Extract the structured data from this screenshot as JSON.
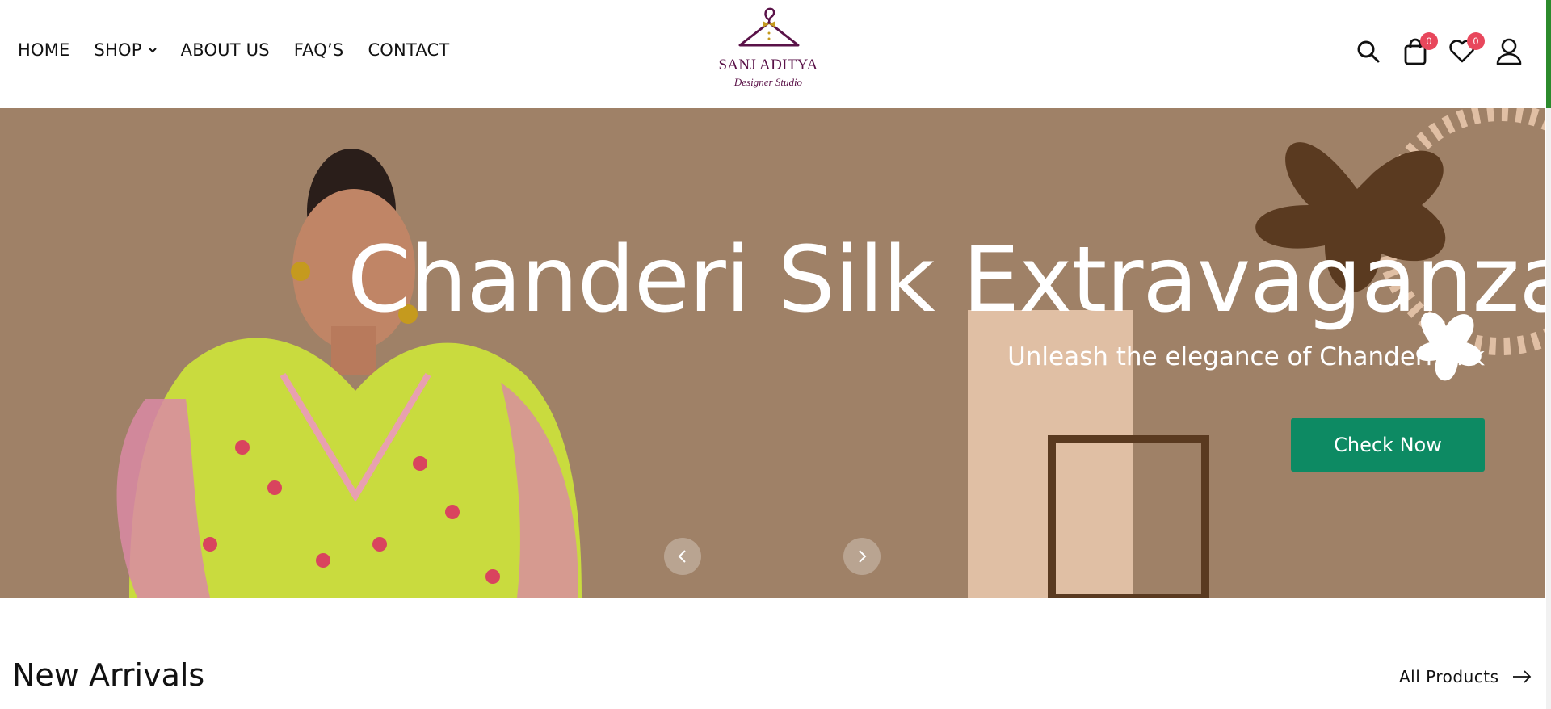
{
  "nav": {
    "items": [
      {
        "label": "HOME"
      },
      {
        "label": "SHOP"
      },
      {
        "label": "ABOUT US"
      },
      {
        "label": "FAQ’S"
      },
      {
        "label": "CONTACT"
      }
    ]
  },
  "logo": {
    "brand": "SANJ ADITYA",
    "tagline": "Designer Studio",
    "icon": "hanger-icon"
  },
  "header_icons": {
    "search": "search-icon",
    "cart": {
      "icon": "shopping-bag-icon",
      "count": "0"
    },
    "wishlist": {
      "icon": "heart-icon",
      "count": "0"
    },
    "account": "user-icon"
  },
  "hero": {
    "title": "Chanderi Silk Extravaganza",
    "subtitle": "Unleash the elegance of Chanderi Silk",
    "cta_label": "Check Now",
    "prev_icon": "chevron-left-icon",
    "next_icon": "chevron-right-icon"
  },
  "section": {
    "title": "New Arrivals",
    "link_label": "All Products",
    "link_icon": "arrow-right-icon"
  },
  "colors": {
    "hero_bg": "#9f8167",
    "cta": "#0d8a63",
    "badge": "#e8475c",
    "brand": "#5a1248",
    "deco_dark": "#5a3a20",
    "deco_light": "#e0bfa4"
  }
}
